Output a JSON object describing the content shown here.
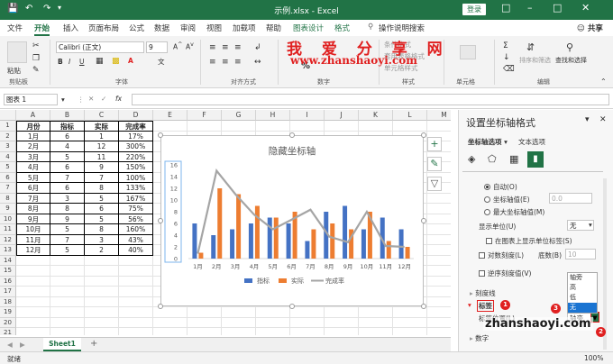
{
  "titlebar": {
    "title": "示例.xlsx - Excel",
    "login": "登录",
    "save_icon": "save-icon",
    "undo_icon": "undo-icon",
    "redo_icon": "redo-icon"
  },
  "tabs": [
    "文件",
    "开始",
    "插入",
    "页面布局",
    "公式",
    "数据",
    "审阅",
    "视图",
    "加载项",
    "帮助",
    "图表设计",
    "格式"
  ],
  "tell_me": "操作说明搜索",
  "share": "共享",
  "ribbon": {
    "paste": "粘贴",
    "clipboard": "剪贴板",
    "font_name": "Calibri (正文)",
    "font_size": "9",
    "font_group": "字体",
    "align_group": "对齐方式",
    "number_group": "数字",
    "cond_format": "条件格式",
    "table_format": "套用表格格式",
    "cell_style": "单元格样式",
    "styles_group": "样式",
    "cells": "单元格",
    "sort_filter": "排序和筛选",
    "find_select": "查找和选择",
    "edit_group": "编辑",
    "percent": "%"
  },
  "watermark": {
    "line1": "我 爱 分 享 网",
    "line2": "www.zhanshaoyi.com"
  },
  "name_box": "图表 1",
  "fx": "fx",
  "columns": [
    "A",
    "B",
    "C",
    "D",
    "E",
    "F",
    "G",
    "H",
    "I",
    "J",
    "K",
    "L",
    "M"
  ],
  "table": {
    "headers": [
      "月份",
      "指标",
      "实际",
      "完成率"
    ],
    "rows": [
      [
        "1月",
        "6",
        "1",
        "17%"
      ],
      [
        "2月",
        "4",
        "12",
        "300%"
      ],
      [
        "3月",
        "5",
        "11",
        "220%"
      ],
      [
        "4月",
        "6",
        "9",
        "150%"
      ],
      [
        "5月",
        "7",
        "7",
        "100%"
      ],
      [
        "6月",
        "6",
        "8",
        "133%"
      ],
      [
        "7月",
        "3",
        "5",
        "167%"
      ],
      [
        "8月",
        "8",
        "6",
        "75%"
      ],
      [
        "9月",
        "9",
        "5",
        "56%"
      ],
      [
        "10月",
        "5",
        "8",
        "160%"
      ],
      [
        "11月",
        "7",
        "3",
        "43%"
      ],
      [
        "12月",
        "5",
        "2",
        "40%"
      ]
    ]
  },
  "chart_data": {
    "type": "bar",
    "title": "隐藏坐标轴",
    "categories": [
      "1月",
      "2月",
      "3月",
      "4月",
      "5月",
      "6月",
      "7月",
      "8月",
      "9月",
      "10月",
      "11月",
      "12月"
    ],
    "series": [
      {
        "name": "指标",
        "type": "bar",
        "color": "#4472c4",
        "values": [
          6,
          4,
          5,
          6,
          7,
          6,
          3,
          8,
          9,
          5,
          7,
          5
        ]
      },
      {
        "name": "实际",
        "type": "bar",
        "color": "#ed7d31",
        "values": [
          1,
          12,
          11,
          9,
          7,
          8,
          5,
          6,
          5,
          8,
          3,
          2
        ]
      },
      {
        "name": "完成率",
        "type": "line",
        "color": "#a5a5a5",
        "values": [
          0.17,
          3.0,
          2.2,
          1.5,
          1.0,
          1.33,
          1.67,
          0.75,
          0.56,
          1.6,
          0.43,
          0.4
        ]
      }
    ],
    "y_ticks": [
      "16",
      "14",
      "12",
      "10",
      "8",
      "6",
      "4",
      "2",
      "0"
    ],
    "ylim": [
      0,
      16
    ],
    "legend": "bottom"
  },
  "sheet": {
    "tab": "Sheet1",
    "add": "+"
  },
  "status": {
    "ready": "就绪",
    "zoom": "100%"
  },
  "pane": {
    "title": "设置坐标轴格式",
    "tab1": "坐标轴选项",
    "tab2": "文本选项",
    "auto": "自动(O)",
    "axis_value": "坐标轴值(E)",
    "axis_value_num": "0.0",
    "max_value": "最大坐标轴值(M)",
    "display_unit": "显示单位(U)",
    "display_unit_val": "无",
    "show_label": "在图表上显示单位标签(S)",
    "log_scale": "对数刻度(L)",
    "base": "底数(B)",
    "base_val": "10",
    "reverse": "逆序刻度值(V)",
    "tickmarks": "刻度线",
    "labels": "标签",
    "label_pos": "标签位置(L)",
    "label_pos_val": "轴旁",
    "number": "数字",
    "dropdown": [
      "轴旁",
      "高",
      "低",
      "无"
    ],
    "badges": [
      "1",
      "2",
      "3"
    ]
  },
  "site": "zhanshaoyi.com"
}
